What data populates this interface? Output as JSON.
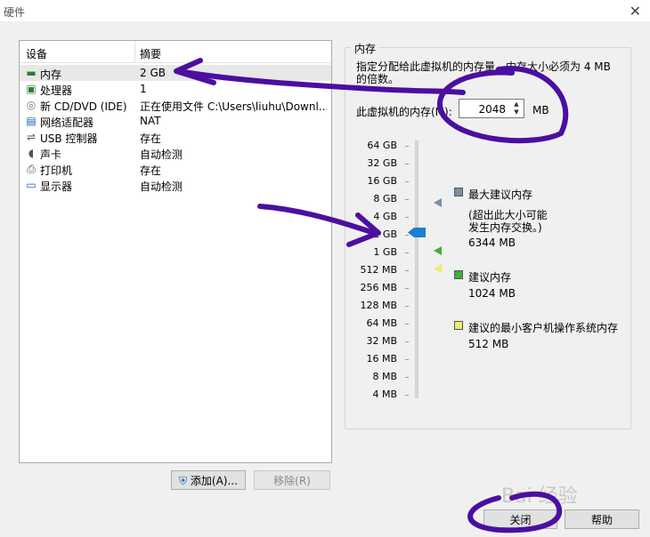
{
  "window": {
    "title": "硬件"
  },
  "devices": {
    "header_device": "设备",
    "header_summary": "摘要",
    "rows": [
      {
        "name": "内存",
        "summary": "2 GB",
        "icon": "memory-icon"
      },
      {
        "name": "处理器",
        "summary": "1",
        "icon": "processor-icon"
      },
      {
        "name": "新 CD/DVD (IDE)",
        "summary": "正在使用文件 C:\\Users\\liuhu\\Downl...",
        "icon": "cd-dvd-icon"
      },
      {
        "name": "网络适配器",
        "summary": "NAT",
        "icon": "network-adapter-icon"
      },
      {
        "name": "USB 控制器",
        "summary": "存在",
        "icon": "usb-icon"
      },
      {
        "name": "声卡",
        "summary": "自动检测",
        "icon": "sound-card-icon"
      },
      {
        "name": "打印机",
        "summary": "存在",
        "icon": "printer-icon"
      },
      {
        "name": "显示器",
        "summary": "自动检测",
        "icon": "display-icon"
      }
    ]
  },
  "buttons": {
    "add": "添加(A)...",
    "remove": "移除(R)",
    "close": "关闭",
    "help": "帮助"
  },
  "memory": {
    "group_label": "内存",
    "description": "指定分配给此虚拟机的内存量。内存大小必须为 4 MB 的倍数。",
    "field_label": "此虚拟机的内存(M):",
    "value": "2048",
    "unit": "MB",
    "scale_labels": [
      "64 GB",
      "32 GB",
      "16 GB",
      "8 GB",
      "4 GB",
      "2 GB",
      "1 GB",
      "512 MB",
      "256 MB",
      "128 MB",
      "64 MB",
      "32 MB",
      "16 MB",
      "8 MB",
      "4 MB"
    ],
    "selected_label": "2 GB",
    "legend": {
      "max_title": "最大建议内存",
      "max_note1": "(超出此大小可能",
      "max_note2": "发生内存交换。)",
      "max_value": "6344 MB",
      "rec_title": "建议内存",
      "rec_value": "1024 MB",
      "min_title": "建议的最小客户机操作系统内存",
      "min_value": "512 MB"
    },
    "colors": {
      "max": "#7d8fa8",
      "rec": "#3bb03b",
      "min": "#ecec6c",
      "slider": "#1a7fd1"
    }
  },
  "watermark": "Bai 经验"
}
